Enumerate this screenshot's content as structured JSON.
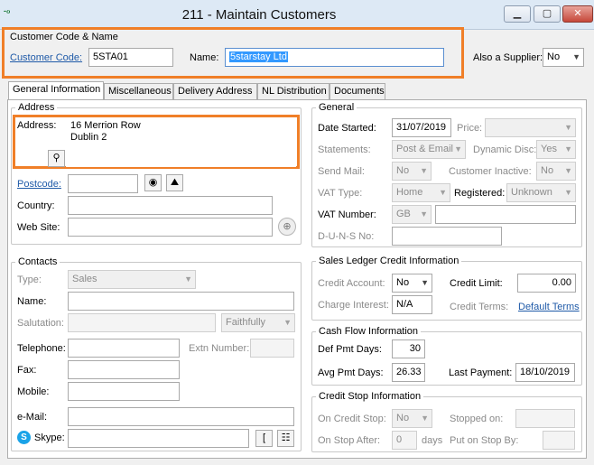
{
  "window": {
    "title": "211 - Maintain Customers",
    "app_icon": "-ℴ",
    "minimize": "▁",
    "maximize": "▢",
    "close": "✕"
  },
  "code_name": {
    "group_title": "Customer Code & Name",
    "code_label": "Customer Code:",
    "code_value": "5STA01",
    "name_label": "Name:",
    "name_value": "5starstay Ltd",
    "supplier_label": "Also a Supplier:",
    "supplier_value": "No"
  },
  "tabs": [
    "General Information",
    "Miscellaneous",
    "Delivery Address",
    "NL Distribution",
    "Documents"
  ],
  "address": {
    "group_title": "Address",
    "address_label": "Address:",
    "line1": "16 Merrion Row",
    "line2": "Dublin 2",
    "pin_icon": "⚲",
    "postcode_label": "Postcode:",
    "postcode_value": "",
    "country_label": "Country:",
    "country_value": "",
    "website_label": "Web Site:",
    "website_value": "",
    "eye_icon": "◉",
    "map_icon": "⛰",
    "globe_icon": "⊕"
  },
  "contacts": {
    "group_title": "Contacts",
    "type_label": "Type:",
    "type_value": "Sales",
    "name_label": "Name:",
    "salutation_label": "Salutation:",
    "salutation_value": "Faithfully",
    "telephone_label": "Telephone:",
    "extn_label": "Extn Number:",
    "fax_label": "Fax:",
    "mobile_label": "Mobile:",
    "email_label": "e-Mail:",
    "skype_label": "Skype:",
    "skype_icon": "S",
    "bracket_icon": "[",
    "tree_icon": "☷"
  },
  "general": {
    "group_title": "General",
    "date_started_label": "Date Started:",
    "date_started_value": "31/07/2019",
    "price_label": "Price:",
    "statements_label": "Statements:",
    "statements_value": "Post & Email",
    "dynamic_disc_label": "Dynamic Disc:",
    "dynamic_disc_value": "Yes",
    "send_mail_label": "Send Mail:",
    "send_mail_value": "No",
    "inactive_label": "Customer Inactive:",
    "inactive_value": "No",
    "vat_type_label": "VAT Type:",
    "vat_type_value": "Home",
    "registered_label": "Registered:",
    "registered_value": "Unknown",
    "vat_number_label": "VAT Number:",
    "vat_number_prefix": "GB",
    "duns_label": "D-U-N-S No:"
  },
  "credit": {
    "group_title": "Sales Ledger Credit Information",
    "account_label": "Credit Account:",
    "account_value": "No",
    "limit_label": "Credit Limit:",
    "limit_value": "0.00",
    "interest_label": "Charge Interest:",
    "interest_value": "N/A",
    "terms_label": "Credit Terms:",
    "terms_link": "Default Terms"
  },
  "cashflow": {
    "group_title": "Cash Flow Information",
    "def_pmt_label": "Def Pmt Days:",
    "def_pmt_value": "30",
    "avg_pmt_label": "Avg Pmt Days:",
    "avg_pmt_value": "26.33",
    "last_payment_label": "Last Payment:",
    "last_payment_value": "18/10/2019"
  },
  "creditstop": {
    "group_title": "Credit Stop Information",
    "on_stop_label": "On Credit Stop:",
    "on_stop_value": "No",
    "stopped_on_label": "Stopped on:",
    "on_stop_after_label": "On Stop After:",
    "on_stop_after_value": "0",
    "days_label": "days",
    "put_on_stop_label": "Put on Stop By:"
  }
}
